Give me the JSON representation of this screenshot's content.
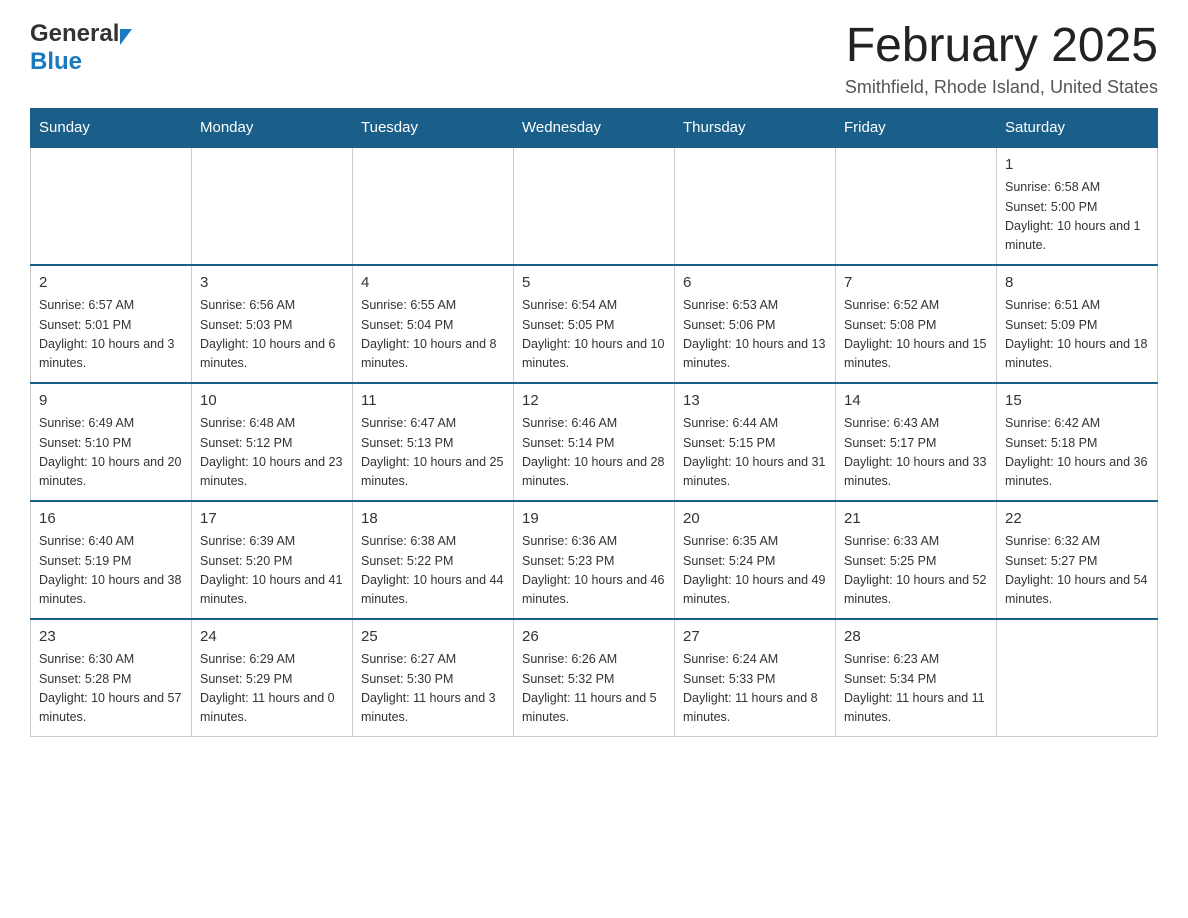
{
  "header": {
    "logo_general": "General",
    "logo_blue": "Blue",
    "month_title": "February 2025",
    "location": "Smithfield, Rhode Island, United States"
  },
  "weekdays": [
    "Sunday",
    "Monday",
    "Tuesday",
    "Wednesday",
    "Thursday",
    "Friday",
    "Saturday"
  ],
  "weeks": [
    [
      {
        "day": "",
        "info": ""
      },
      {
        "day": "",
        "info": ""
      },
      {
        "day": "",
        "info": ""
      },
      {
        "day": "",
        "info": ""
      },
      {
        "day": "",
        "info": ""
      },
      {
        "day": "",
        "info": ""
      },
      {
        "day": "1",
        "info": "Sunrise: 6:58 AM\nSunset: 5:00 PM\nDaylight: 10 hours and 1 minute."
      }
    ],
    [
      {
        "day": "2",
        "info": "Sunrise: 6:57 AM\nSunset: 5:01 PM\nDaylight: 10 hours and 3 minutes."
      },
      {
        "day": "3",
        "info": "Sunrise: 6:56 AM\nSunset: 5:03 PM\nDaylight: 10 hours and 6 minutes."
      },
      {
        "day": "4",
        "info": "Sunrise: 6:55 AM\nSunset: 5:04 PM\nDaylight: 10 hours and 8 minutes."
      },
      {
        "day": "5",
        "info": "Sunrise: 6:54 AM\nSunset: 5:05 PM\nDaylight: 10 hours and 10 minutes."
      },
      {
        "day": "6",
        "info": "Sunrise: 6:53 AM\nSunset: 5:06 PM\nDaylight: 10 hours and 13 minutes."
      },
      {
        "day": "7",
        "info": "Sunrise: 6:52 AM\nSunset: 5:08 PM\nDaylight: 10 hours and 15 minutes."
      },
      {
        "day": "8",
        "info": "Sunrise: 6:51 AM\nSunset: 5:09 PM\nDaylight: 10 hours and 18 minutes."
      }
    ],
    [
      {
        "day": "9",
        "info": "Sunrise: 6:49 AM\nSunset: 5:10 PM\nDaylight: 10 hours and 20 minutes."
      },
      {
        "day": "10",
        "info": "Sunrise: 6:48 AM\nSunset: 5:12 PM\nDaylight: 10 hours and 23 minutes."
      },
      {
        "day": "11",
        "info": "Sunrise: 6:47 AM\nSunset: 5:13 PM\nDaylight: 10 hours and 25 minutes."
      },
      {
        "day": "12",
        "info": "Sunrise: 6:46 AM\nSunset: 5:14 PM\nDaylight: 10 hours and 28 minutes."
      },
      {
        "day": "13",
        "info": "Sunrise: 6:44 AM\nSunset: 5:15 PM\nDaylight: 10 hours and 31 minutes."
      },
      {
        "day": "14",
        "info": "Sunrise: 6:43 AM\nSunset: 5:17 PM\nDaylight: 10 hours and 33 minutes."
      },
      {
        "day": "15",
        "info": "Sunrise: 6:42 AM\nSunset: 5:18 PM\nDaylight: 10 hours and 36 minutes."
      }
    ],
    [
      {
        "day": "16",
        "info": "Sunrise: 6:40 AM\nSunset: 5:19 PM\nDaylight: 10 hours and 38 minutes."
      },
      {
        "day": "17",
        "info": "Sunrise: 6:39 AM\nSunset: 5:20 PM\nDaylight: 10 hours and 41 minutes."
      },
      {
        "day": "18",
        "info": "Sunrise: 6:38 AM\nSunset: 5:22 PM\nDaylight: 10 hours and 44 minutes."
      },
      {
        "day": "19",
        "info": "Sunrise: 6:36 AM\nSunset: 5:23 PM\nDaylight: 10 hours and 46 minutes."
      },
      {
        "day": "20",
        "info": "Sunrise: 6:35 AM\nSunset: 5:24 PM\nDaylight: 10 hours and 49 minutes."
      },
      {
        "day": "21",
        "info": "Sunrise: 6:33 AM\nSunset: 5:25 PM\nDaylight: 10 hours and 52 minutes."
      },
      {
        "day": "22",
        "info": "Sunrise: 6:32 AM\nSunset: 5:27 PM\nDaylight: 10 hours and 54 minutes."
      }
    ],
    [
      {
        "day": "23",
        "info": "Sunrise: 6:30 AM\nSunset: 5:28 PM\nDaylight: 10 hours and 57 minutes."
      },
      {
        "day": "24",
        "info": "Sunrise: 6:29 AM\nSunset: 5:29 PM\nDaylight: 11 hours and 0 minutes."
      },
      {
        "day": "25",
        "info": "Sunrise: 6:27 AM\nSunset: 5:30 PM\nDaylight: 11 hours and 3 minutes."
      },
      {
        "day": "26",
        "info": "Sunrise: 6:26 AM\nSunset: 5:32 PM\nDaylight: 11 hours and 5 minutes."
      },
      {
        "day": "27",
        "info": "Sunrise: 6:24 AM\nSunset: 5:33 PM\nDaylight: 11 hours and 8 minutes."
      },
      {
        "day": "28",
        "info": "Sunrise: 6:23 AM\nSunset: 5:34 PM\nDaylight: 11 hours and 11 minutes."
      },
      {
        "day": "",
        "info": ""
      }
    ]
  ]
}
